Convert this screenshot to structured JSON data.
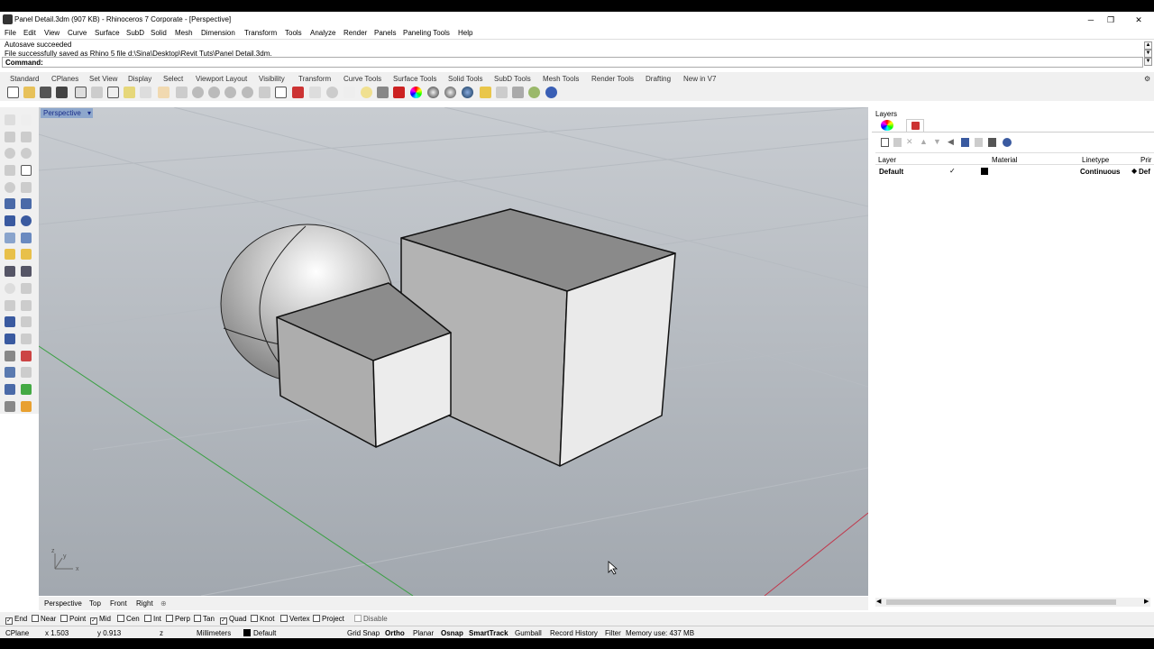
{
  "window": {
    "title": "Panel Detail.3dm (907 KB) - Rhinoceros 7 Corporate - [Perspective]",
    "minimize": "─",
    "restore": "❐",
    "close": "✕"
  },
  "menu": [
    "File",
    "Edit",
    "View",
    "Curve",
    "Surface",
    "SubD",
    "Solid",
    "Mesh",
    "Dimension",
    "Transform",
    "Tools",
    "Analyze",
    "Render",
    "Panels",
    "Paneling Tools",
    "Help"
  ],
  "command": {
    "history": [
      "Autosave succeeded",
      "File successfully saved as Rhino 5 file d:\\Sina\\Desktop\\Revit Tuts\\Panel Detail.3dm."
    ],
    "prompt": "Command:"
  },
  "toolbar_tabs": [
    "Standard",
    "CPlanes",
    "Set View",
    "Display",
    "Select",
    "Viewport Layout",
    "Visibility",
    "Transform",
    "Curve Tools",
    "Surface Tools",
    "Solid Tools",
    "SubD Tools",
    "Mesh Tools",
    "Render Tools",
    "Drafting",
    "New in V7"
  ],
  "toolbar_icons": [
    "new-icon",
    "open-icon",
    "save-icon",
    "print-icon",
    "import-icon",
    "cut-icon",
    "copy-icon",
    "paste-icon",
    "undo-icon",
    "pan-icon",
    "rotate-view-icon",
    "zoom-icon",
    "zoom-window-icon",
    "zoom-extents-icon",
    "zoom-selected-icon",
    "undo-view-icon",
    "four-viewports-icon",
    "cplane-icon",
    "grid-icon",
    "light-icon",
    "lock-icon",
    "properties-icon",
    "color-icon",
    "material-icon",
    "render-icon",
    "render-preview-icon",
    "environment-icon",
    "sun-icon",
    "filter-icon",
    "options-icon",
    "help-icon"
  ],
  "viewport": {
    "active_label": "Perspective",
    "axis_x": "x",
    "axis_y": "y",
    "axis_z": "z"
  },
  "viewport_tabs": [
    "Perspective",
    "Top",
    "Front",
    "Right",
    "⊕"
  ],
  "layers_panel": {
    "title": "Layers",
    "columns": [
      "Layer",
      "Material",
      "Linetype",
      "Prir"
    ],
    "rows": [
      {
        "name": "Default",
        "current": "✓",
        "linetype": "Continuous",
        "print": "Def"
      }
    ]
  },
  "osnaps": [
    {
      "label": "End",
      "checked": true
    },
    {
      "label": "Near",
      "checked": false
    },
    {
      "label": "Point",
      "checked": false
    },
    {
      "label": "Mid",
      "checked": true
    },
    {
      "label": "Cen",
      "checked": false
    },
    {
      "label": "Int",
      "checked": false
    },
    {
      "label": "Perp",
      "checked": false
    },
    {
      "label": "Tan",
      "checked": false
    },
    {
      "label": "Quad",
      "checked": true
    },
    {
      "label": "Knot",
      "checked": false
    },
    {
      "label": "Vertex",
      "checked": false
    },
    {
      "label": "Project",
      "checked": false
    },
    {
      "label": "Disable",
      "checked": false
    }
  ],
  "status": {
    "cplane": "CPlane",
    "x": "x 1.503",
    "y": "y 0.913",
    "z": "z",
    "units": "Millimeters",
    "layer": "Default",
    "grid_snap": "Grid Snap",
    "ortho": "Ortho",
    "planar": "Planar",
    "osnap": "Osnap",
    "smarttrack": "SmartTrack",
    "gumball": "Gumball",
    "record_history": "Record History",
    "filter": "Filter",
    "memory": "Memory use: 437 MB"
  },
  "colors": {
    "viewport_top": "#c8ccd1",
    "viewport_bottom": "#a2a8af",
    "x_axis": "#c0394d",
    "y_axis": "#3aa043",
    "label_bg": "#8ea7cc"
  }
}
